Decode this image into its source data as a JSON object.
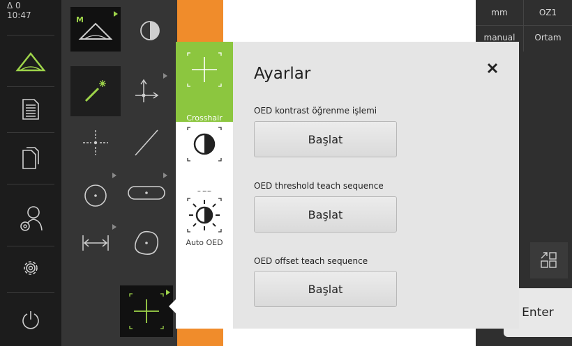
{
  "status": {
    "delta": "Δ 0",
    "time": "10:47"
  },
  "sidebar": {
    "items": [
      {
        "icon": "measure-icon"
      },
      {
        "icon": "document-icon"
      },
      {
        "icon": "files-icon"
      },
      {
        "icon": "user-settings-icon"
      },
      {
        "icon": "settings-icon"
      },
      {
        "icon": "power-icon"
      }
    ]
  },
  "palette": {
    "manual_label": "M",
    "tools": [
      "manual-measure",
      "oed-contrast",
      "measure-wand",
      "point-coordinate",
      "point",
      "line",
      "circle",
      "slot",
      "distance",
      "blob",
      "crosshair"
    ]
  },
  "right_panel": {
    "unit": "mm",
    "reference": "OZ1",
    "mode": "manual",
    "filter": "Ortam",
    "enter_label": "Enter"
  },
  "dialog": {
    "title": "Ayarlar",
    "tabs": [
      {
        "label": "Crosshair",
        "active": true
      },
      {
        "label": "OED",
        "active": false
      },
      {
        "label": "Auto OED",
        "active": false
      }
    ],
    "sections": [
      {
        "label": "OED kontrast öğrenme işlemi",
        "button": "Başlat"
      },
      {
        "label": "OED threshold teach sequence",
        "button": "Başlat"
      },
      {
        "label": "OED offset teach sequence",
        "button": "Başlat"
      }
    ]
  },
  "colors": {
    "accent_green": "#8cc63f",
    "orange": "#f08c2b",
    "icon_green": "#9ed44a"
  }
}
